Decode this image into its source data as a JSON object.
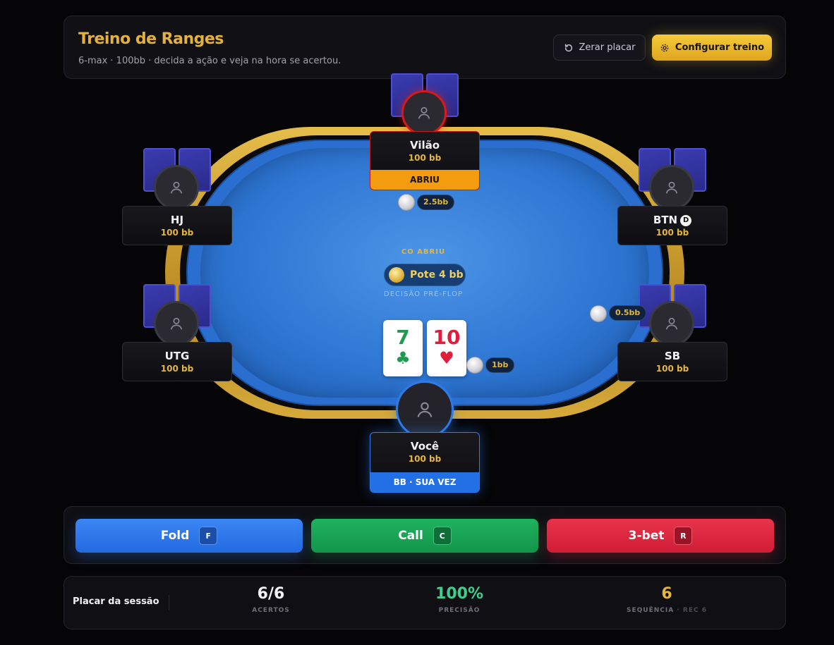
{
  "header": {
    "title": "Treino de Ranges",
    "subtitle": "6-max · 100bb · decida a ação e veja na hora se acertou.",
    "reset_label": "Zerar placar",
    "config_label": "Configurar treino"
  },
  "table": {
    "situation": "CO ABRIU",
    "pot_label": "Pote 4 bb",
    "phase": "DECISÃO PRÉ-FLOP"
  },
  "seats": {
    "villain": {
      "name": "Vilão",
      "stack": "100 bb",
      "tag": "ABRIU",
      "bet": "2.5bb"
    },
    "hj": {
      "name": "HJ",
      "stack": "100 bb"
    },
    "btn": {
      "name": "BTN",
      "stack": "100 bb",
      "dealer": "D"
    },
    "utg": {
      "name": "UTG",
      "stack": "100 bb"
    },
    "sb": {
      "name": "SB",
      "stack": "100 bb",
      "bet": "0.5bb"
    },
    "hero": {
      "name": "Você",
      "stack": "100 bb",
      "tag": "BB · SUA VEZ",
      "bet": "1bb"
    }
  },
  "hero_cards": [
    {
      "rank": "7",
      "suit": "♣",
      "color": "#1f9a50"
    },
    {
      "rank": "10",
      "suit": "♥",
      "color": "#e11d3c"
    }
  ],
  "actions": {
    "fold": {
      "label": "Fold",
      "key": "F"
    },
    "call": {
      "label": "Call",
      "key": "C"
    },
    "bet3": {
      "label": "3-bet",
      "key": "R"
    }
  },
  "score": {
    "label": "Placar da sessão",
    "hits": {
      "value": "6/6",
      "label": "ACERTOS"
    },
    "accuracy": {
      "value": "100%",
      "label": "PRECISÃO"
    },
    "streak": {
      "value": "6",
      "label": "SEQUÊNCIA",
      "record": "· REC 6"
    }
  },
  "colors": {
    "gold": "#e3b23c",
    "accuracy": "#3ecf8e",
    "streak": "#e4b63c"
  }
}
